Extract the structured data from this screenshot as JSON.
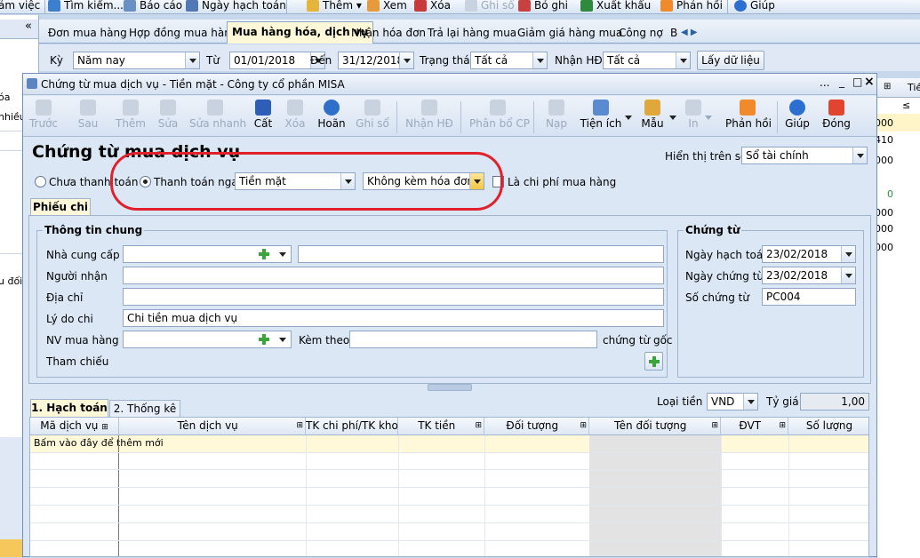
{
  "top_toolbar": {
    "items": [
      "ảm việc",
      "Tìm kiếm...",
      "Báo cáo",
      "Ngày hạch toán",
      "Thêm",
      "Xem",
      "Xóa",
      "Ghi sổ",
      "Bỏ ghi",
      "Xuất khẩu",
      "Phản hồi",
      "Giúp"
    ]
  },
  "left_panel": {
    "items": [
      "óa",
      "nhiều",
      "u đối"
    ],
    "collapse": "«"
  },
  "tabs": {
    "items": [
      "Đơn mua hàng",
      "Hợp đồng mua hàng",
      "Mua hàng hóa, dịch vụ",
      "Nhận hóa đơn",
      "Trả lại hàng mua",
      "Giảm giá hàng mua",
      "Công nợ",
      "B"
    ]
  },
  "filter": {
    "ky_label": "Kỳ",
    "ky_value": "Năm nay",
    "tu_label": "Từ",
    "tu_value": "01/01/2018",
    "den_label": "Đến",
    "den_value": "31/12/2018",
    "trang_thai_label": "Trạng thái",
    "trang_thai_value": "Tất cả",
    "nhan_hd_label": "Nhận HĐ",
    "nhan_hd_value": "Tất cả",
    "load_button": "Lấy dữ liệu"
  },
  "right_strip": {
    "header": "Tiề",
    "values": [
      "000",
      "410",
      "000",
      "0",
      "000",
      "000",
      "000"
    ]
  },
  "dialog": {
    "title": "Chứng từ mua dịch vụ - Tiền mặt - Công ty cổ phần MISA",
    "window_controls": [
      "...",
      "_",
      "□",
      "×"
    ],
    "toolbar": [
      "Trước",
      "Sau",
      "Thêm",
      "Sửa",
      "Sửa nhanh",
      "Cất",
      "Xóa",
      "Hoãn",
      "Ghi sổ",
      "Nhận HĐ",
      "Phân bổ CP",
      "Nạp",
      "Tiện ích",
      "Mẫu",
      "In",
      "Phản hồi",
      "Giúp",
      "Đóng"
    ],
    "heading": "Chứng từ mua dịch vụ",
    "hien_thi_label": "Hiển thị trên sổ",
    "hien_thi_value": "Sổ tài chính",
    "radio_unpaid": "Chưa thanh toán",
    "radio_paid": "Thanh toán ngay",
    "payment_method": "Tiền mặt",
    "invoice_option": "Không kèm hóa đơn",
    "purchase_cost_label": "Là chi phí mua hàng",
    "section_tab": "Phiếu chi",
    "general": {
      "title": "Thông tin chung",
      "supplier": "Nhà cung cấp",
      "receiver": "Người nhận",
      "address": "Địa chỉ",
      "reason": "Lý do chi",
      "reason_value": "Chi tiền mua dịch vụ",
      "staff": "NV mua hàng",
      "attach": "Kèm theo",
      "original_docs": "chứng từ gốc",
      "reference": "Tham chiếu"
    },
    "voucher": {
      "title": "Chứng từ",
      "posting_date_label": "Ngày hạch toán",
      "posting_date": "23/02/2018",
      "doc_date_label": "Ngày chứng từ",
      "doc_date": "23/02/2018",
      "doc_no_label": "Số chứng từ",
      "doc_no": "PC004"
    },
    "grid_tabs": [
      "1. Hạch toán",
      "2. Thống kê"
    ],
    "currency_label": "Loại tiền",
    "currency": "VND",
    "rate_label": "Tỷ giá",
    "rate": "1,00",
    "columns": [
      "Mã dịch vụ",
      "Tên dịch vụ",
      "TK chi phí/TK kho",
      "TK tiền",
      "Đối tượng",
      "Tên đối tượng",
      "ĐVT",
      "Số lượng"
    ],
    "add_row_hint": "Bấm vào đây để thêm mới"
  },
  "colors": {
    "highlight": "#e0202a",
    "active_tab": "#fff8d8",
    "add_row": "#fff9d9"
  }
}
